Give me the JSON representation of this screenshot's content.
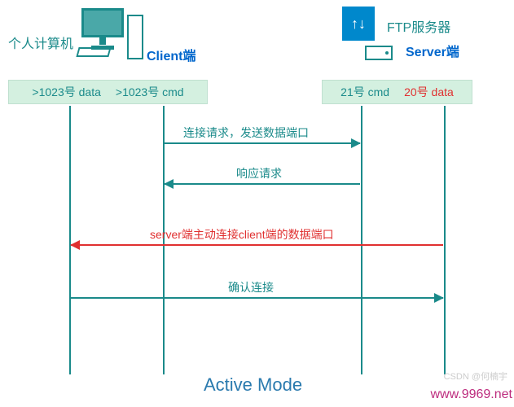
{
  "left": {
    "title": "个人计算机",
    "role": "Client端",
    "port_data": ">1023号 data",
    "port_cmd": ">1023号 cmd"
  },
  "right": {
    "title": "FTP服务器",
    "role": "Server端",
    "port_cmd": "21号 cmd",
    "port_data": "20号 data"
  },
  "arrows": {
    "a1": "连接请求，发送数据端口",
    "a2": "响应请求",
    "a3": "server端主动连接client端的数据端口",
    "a4": "确认连接"
  },
  "mode": "Active Mode",
  "watermark": "CSDN @何楠宇",
  "url": "www.9969.net"
}
